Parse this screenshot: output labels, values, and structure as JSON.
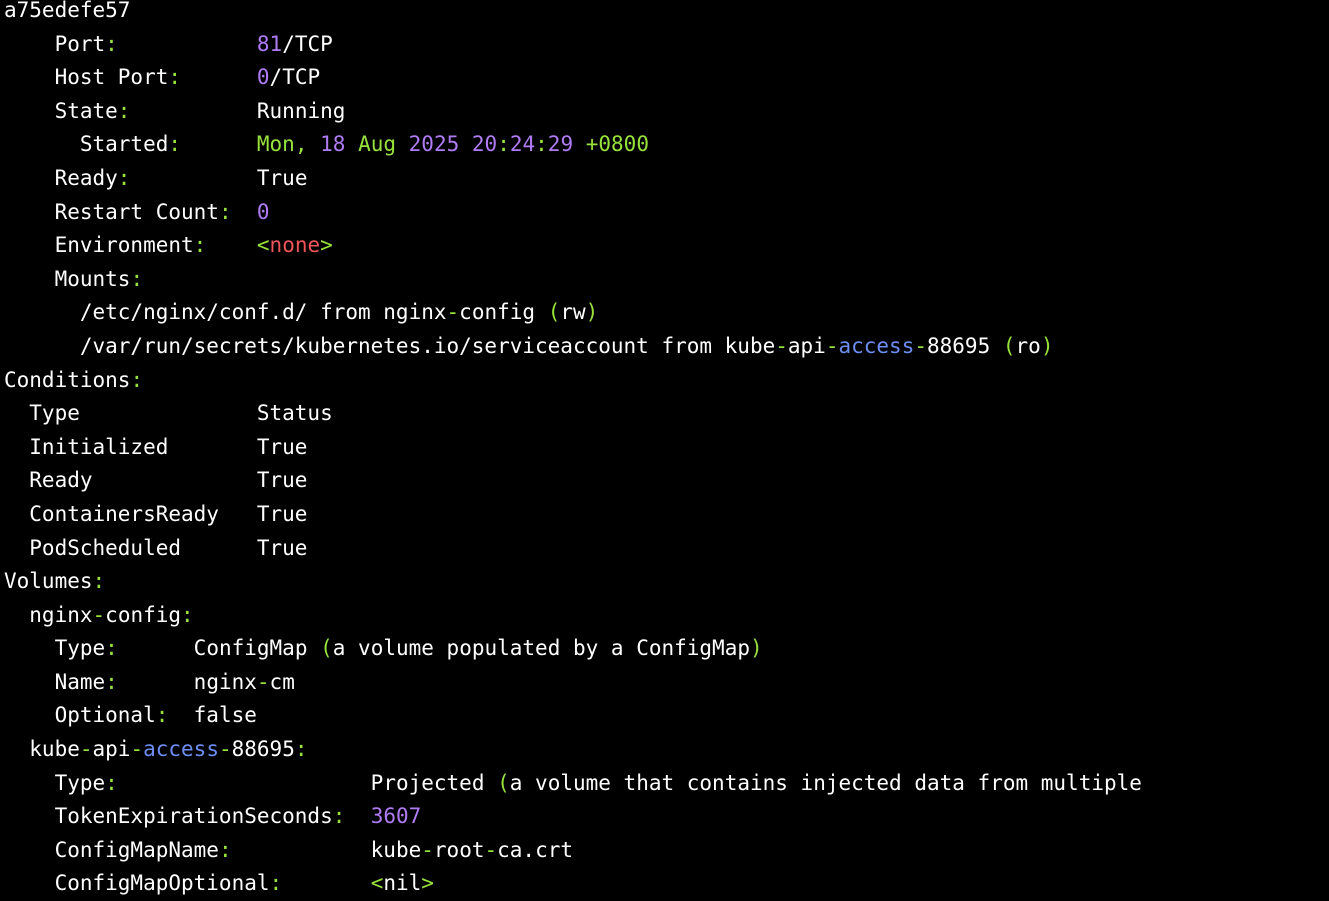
{
  "colors": {
    "background": "#000000",
    "text": "#ffffff",
    "green": "#97e33b",
    "purple": "#b07cf5",
    "blue": "#6d8ef5",
    "red": "#f0555a"
  },
  "lines": [
    [
      {
        "t": "a75edefe57",
        "c": "w"
      }
    ],
    [
      {
        "t": "    Port",
        "c": "w"
      },
      {
        "t": ":",
        "c": "g"
      },
      {
        "t": "           ",
        "c": "w"
      },
      {
        "t": "81",
        "c": "p"
      },
      {
        "t": "/TCP",
        "c": "w"
      }
    ],
    [
      {
        "t": "    Host Port",
        "c": "w"
      },
      {
        "t": ":",
        "c": "g"
      },
      {
        "t": "      ",
        "c": "w"
      },
      {
        "t": "0",
        "c": "p"
      },
      {
        "t": "/TCP",
        "c": "w"
      }
    ],
    [
      {
        "t": "    State",
        "c": "w"
      },
      {
        "t": ":",
        "c": "g"
      },
      {
        "t": "          Running",
        "c": "w"
      }
    ],
    [
      {
        "t": "      Started",
        "c": "w"
      },
      {
        "t": ":",
        "c": "g"
      },
      {
        "t": "      ",
        "c": "w"
      },
      {
        "t": "Mon, ",
        "c": "g"
      },
      {
        "t": "18",
        "c": "p"
      },
      {
        "t": " ",
        "c": "w"
      },
      {
        "t": "Aug",
        "c": "g"
      },
      {
        "t": " ",
        "c": "w"
      },
      {
        "t": "2025",
        "c": "p"
      },
      {
        "t": " ",
        "c": "w"
      },
      {
        "t": "20",
        "c": "p"
      },
      {
        "t": ":",
        "c": "g"
      },
      {
        "t": "24",
        "c": "p"
      },
      {
        "t": ":",
        "c": "g"
      },
      {
        "t": "29",
        "c": "p"
      },
      {
        "t": " ",
        "c": "w"
      },
      {
        "t": "+0800",
        "c": "g"
      }
    ],
    [
      {
        "t": "    Ready",
        "c": "w"
      },
      {
        "t": ":",
        "c": "g"
      },
      {
        "t": "          True",
        "c": "w"
      }
    ],
    [
      {
        "t": "    Restart Count",
        "c": "w"
      },
      {
        "t": ":",
        "c": "g"
      },
      {
        "t": "  ",
        "c": "w"
      },
      {
        "t": "0",
        "c": "p"
      }
    ],
    [
      {
        "t": "    Environment",
        "c": "w"
      },
      {
        "t": ":",
        "c": "g"
      },
      {
        "t": "    ",
        "c": "w"
      },
      {
        "t": "<",
        "c": "g"
      },
      {
        "t": "none",
        "c": "r"
      },
      {
        "t": ">",
        "c": "g"
      }
    ],
    [
      {
        "t": "    Mounts",
        "c": "w"
      },
      {
        "t": ":",
        "c": "g"
      }
    ],
    [
      {
        "t": "      /etc/nginx/conf.d/ from nginx",
        "c": "w"
      },
      {
        "t": "-",
        "c": "g"
      },
      {
        "t": "config ",
        "c": "w"
      },
      {
        "t": "(",
        "c": "g"
      },
      {
        "t": "rw",
        "c": "w"
      },
      {
        "t": ")",
        "c": "g"
      }
    ],
    [
      {
        "t": "      /var/run/secrets/kubernetes.io/serviceaccount from kube",
        "c": "w"
      },
      {
        "t": "-",
        "c": "g"
      },
      {
        "t": "api",
        "c": "w"
      },
      {
        "t": "-",
        "c": "g"
      },
      {
        "t": "access",
        "c": "b"
      },
      {
        "t": "-",
        "c": "g"
      },
      {
        "t": "88695 ",
        "c": "w"
      },
      {
        "t": "(",
        "c": "g"
      },
      {
        "t": "ro",
        "c": "w"
      },
      {
        "t": ")",
        "c": "g"
      }
    ],
    [
      {
        "t": "Conditions",
        "c": "w"
      },
      {
        "t": ":",
        "c": "g"
      }
    ],
    [
      {
        "t": "  Type              Status",
        "c": "w"
      }
    ],
    [
      {
        "t": "  Initialized       True",
        "c": "w"
      }
    ],
    [
      {
        "t": "  Ready             True",
        "c": "w"
      }
    ],
    [
      {
        "t": "  ContainersReady   True",
        "c": "w"
      }
    ],
    [
      {
        "t": "  PodScheduled      True",
        "c": "w"
      }
    ],
    [
      {
        "t": "Volumes",
        "c": "w"
      },
      {
        "t": ":",
        "c": "g"
      }
    ],
    [
      {
        "t": "  nginx",
        "c": "w"
      },
      {
        "t": "-",
        "c": "g"
      },
      {
        "t": "config",
        "c": "w"
      },
      {
        "t": ":",
        "c": "g"
      }
    ],
    [
      {
        "t": "    Type",
        "c": "w"
      },
      {
        "t": ":",
        "c": "g"
      },
      {
        "t": "      ConfigMap ",
        "c": "w"
      },
      {
        "t": "(",
        "c": "g"
      },
      {
        "t": "a volume populated by a ConfigMap",
        "c": "w"
      },
      {
        "t": ")",
        "c": "g"
      }
    ],
    [
      {
        "t": "    Name",
        "c": "w"
      },
      {
        "t": ":",
        "c": "g"
      },
      {
        "t": "      nginx",
        "c": "w"
      },
      {
        "t": "-",
        "c": "g"
      },
      {
        "t": "cm",
        "c": "w"
      }
    ],
    [
      {
        "t": "    Optional",
        "c": "w"
      },
      {
        "t": ":",
        "c": "g"
      },
      {
        "t": "  false",
        "c": "w"
      }
    ],
    [
      {
        "t": "  kube",
        "c": "w"
      },
      {
        "t": "-",
        "c": "g"
      },
      {
        "t": "api",
        "c": "w"
      },
      {
        "t": "-",
        "c": "g"
      },
      {
        "t": "access",
        "c": "b"
      },
      {
        "t": "-",
        "c": "g"
      },
      {
        "t": "88695",
        "c": "w"
      },
      {
        "t": ":",
        "c": "g"
      }
    ],
    [
      {
        "t": "    Type",
        "c": "w"
      },
      {
        "t": ":",
        "c": "g"
      },
      {
        "t": "                    Projected ",
        "c": "w"
      },
      {
        "t": "(",
        "c": "g"
      },
      {
        "t": "a volume that contains injected data from multiple",
        "c": "w"
      }
    ],
    [
      {
        "t": "    TokenExpirationSeconds",
        "c": "w"
      },
      {
        "t": ":",
        "c": "g"
      },
      {
        "t": "  ",
        "c": "w"
      },
      {
        "t": "3607",
        "c": "p"
      }
    ],
    [
      {
        "t": "    ConfigMapName",
        "c": "w"
      },
      {
        "t": ":",
        "c": "g"
      },
      {
        "t": "           kube",
        "c": "w"
      },
      {
        "t": "-",
        "c": "g"
      },
      {
        "t": "root",
        "c": "w"
      },
      {
        "t": "-",
        "c": "g"
      },
      {
        "t": "ca.crt",
        "c": "w"
      }
    ],
    [
      {
        "t": "    ConfigMapOptional",
        "c": "w"
      },
      {
        "t": ":",
        "c": "g"
      },
      {
        "t": "       ",
        "c": "w"
      },
      {
        "t": "<",
        "c": "g"
      },
      {
        "t": "nil",
        "c": "w"
      },
      {
        "t": ">",
        "c": "g"
      }
    ]
  ]
}
